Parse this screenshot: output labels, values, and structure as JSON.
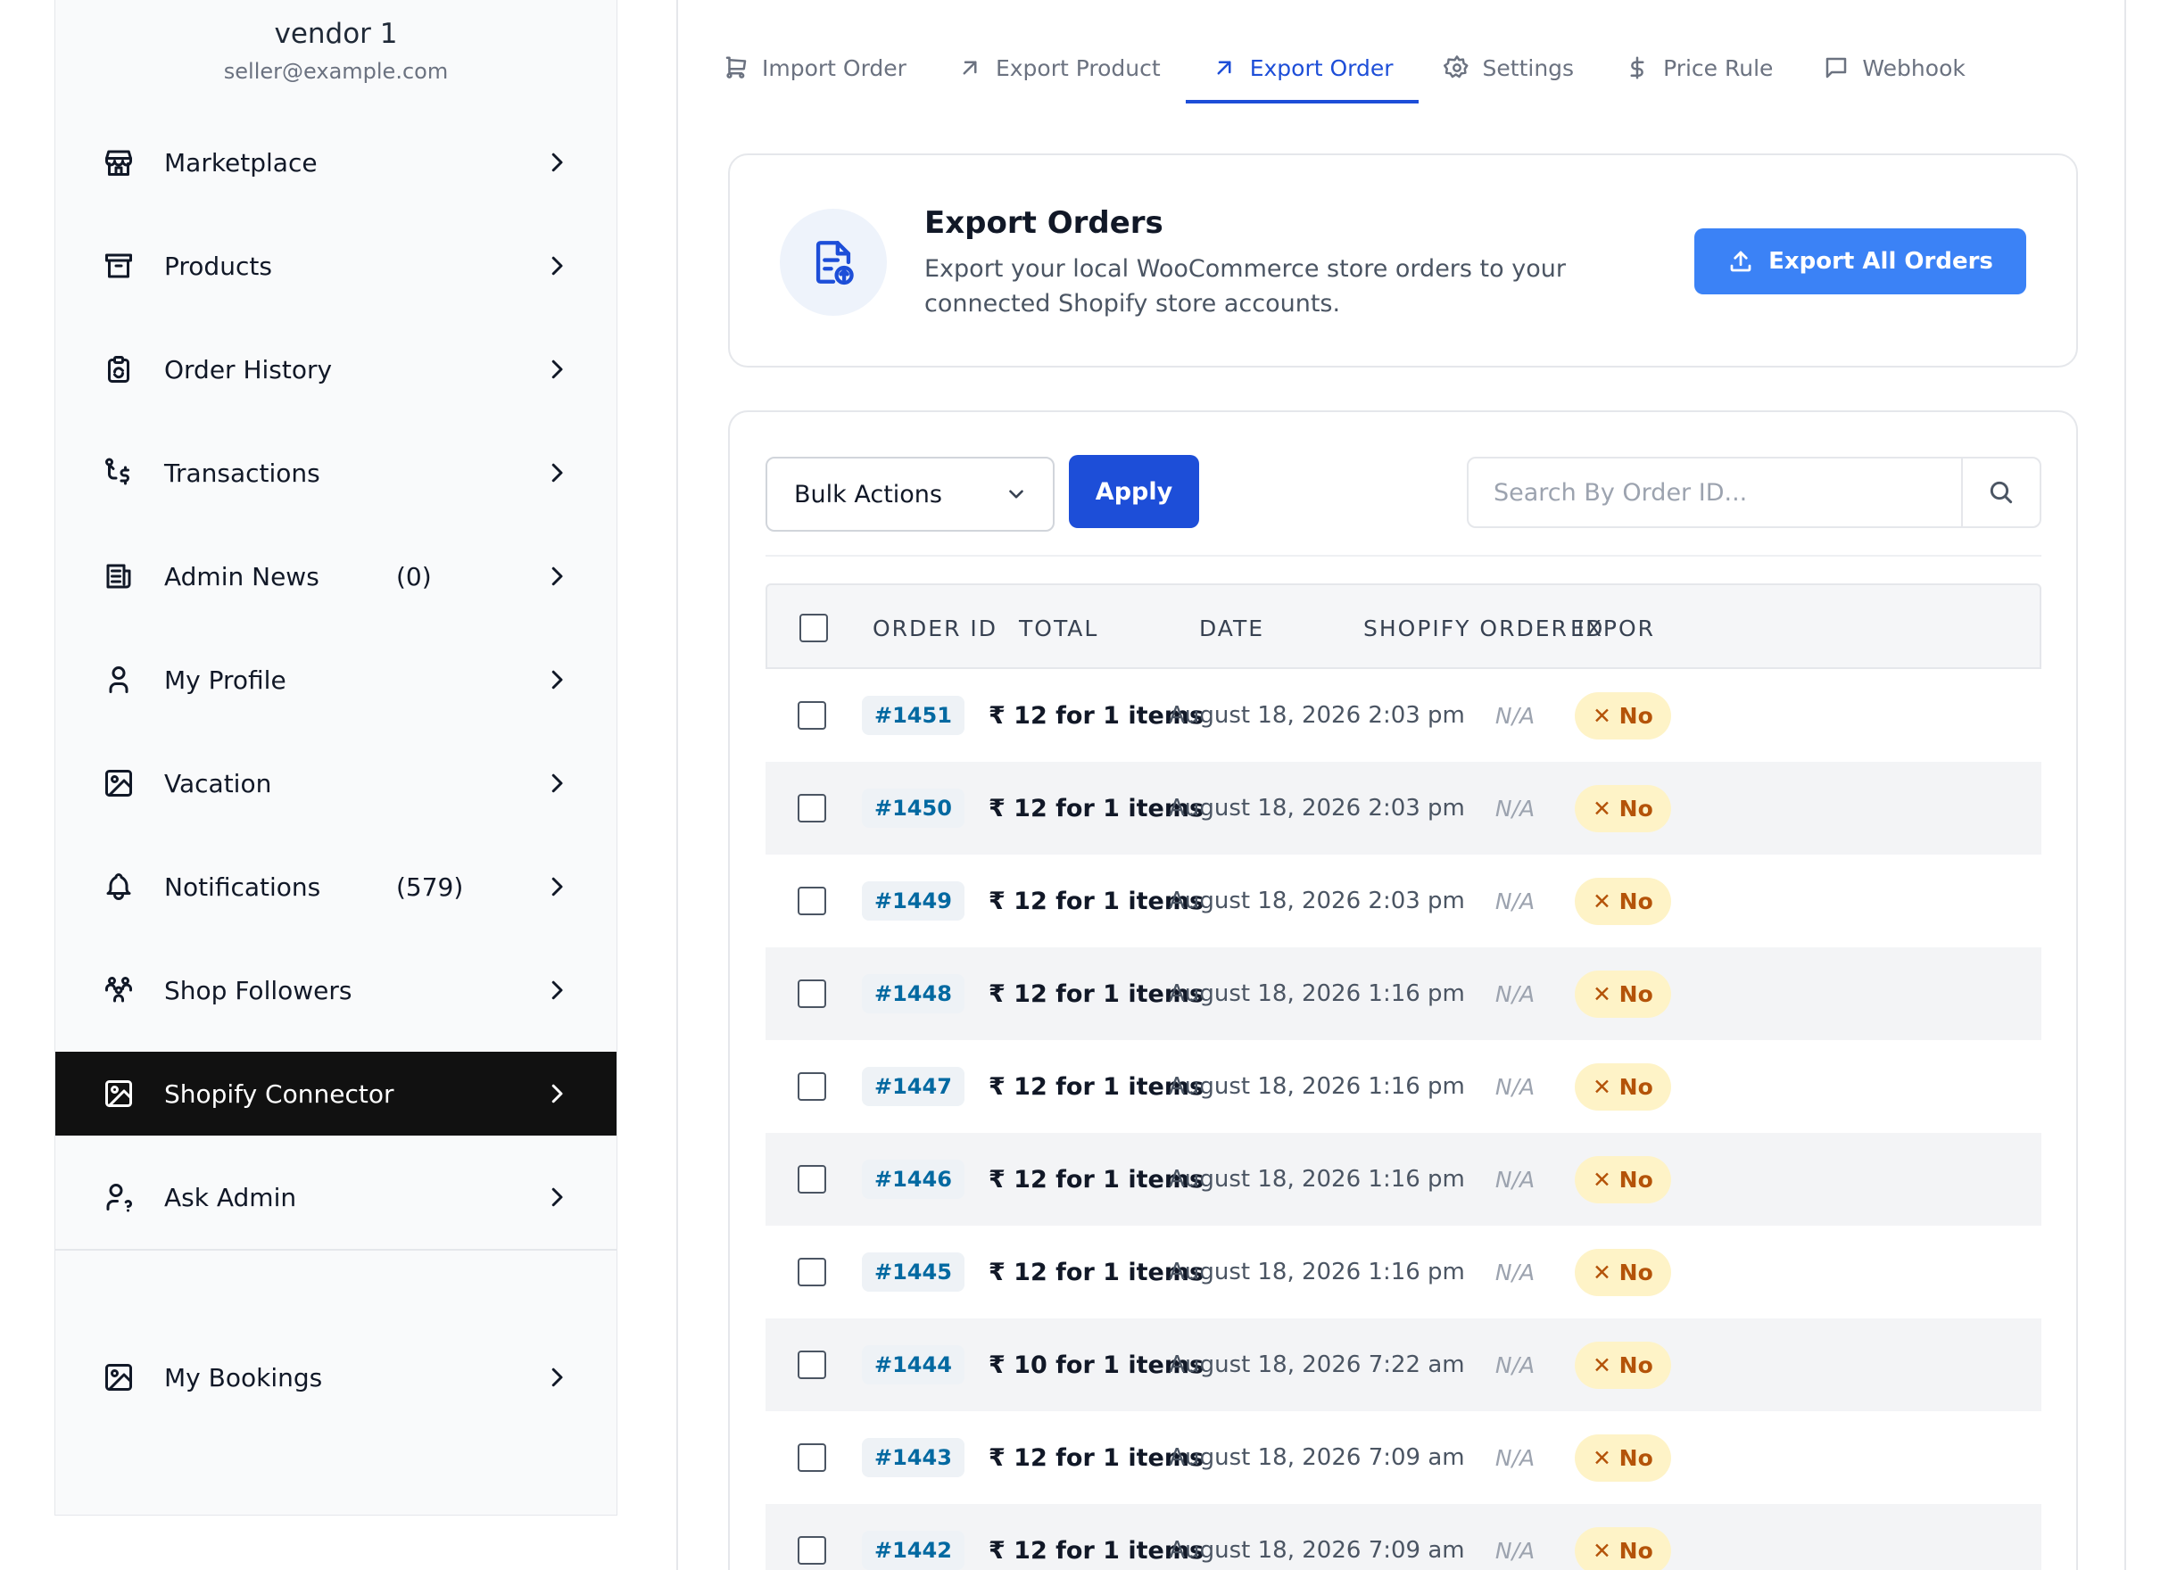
{
  "sidebar": {
    "vendor_name": "vendor 1",
    "vendor_email": "seller@example.com",
    "items": [
      {
        "label": "Marketplace",
        "icon": "store-icon",
        "count": ""
      },
      {
        "label": "Products",
        "icon": "archive-icon",
        "count": ""
      },
      {
        "label": "Order History",
        "icon": "clipboard-refresh-icon",
        "count": ""
      },
      {
        "label": "Transactions",
        "icon": "transaction-dollar-icon",
        "count": ""
      },
      {
        "label": "Admin News",
        "icon": "news-icon",
        "count": "(0)"
      },
      {
        "label": "My Profile",
        "icon": "user-icon",
        "count": ""
      },
      {
        "label": "Vacation",
        "icon": "image-icon",
        "count": ""
      },
      {
        "label": "Notifications",
        "icon": "bell-icon",
        "count": "(579)"
      },
      {
        "label": "Shop Followers",
        "icon": "users-icon",
        "count": ""
      },
      {
        "label": "Shopify Connector",
        "icon": "image-icon",
        "count": "",
        "active": true
      },
      {
        "label": "Ask Admin",
        "icon": "user-question-icon",
        "count": ""
      }
    ],
    "bottom_item": {
      "label": "My Bookings",
      "icon": "image-icon"
    }
  },
  "tabs": [
    {
      "label": "Import Order",
      "icon": "cart-icon"
    },
    {
      "label": "Export Product",
      "icon": "arrow-up-right-icon"
    },
    {
      "label": "Export Order",
      "icon": "arrow-up-right-icon",
      "active": true
    },
    {
      "label": "Settings",
      "icon": "gear-icon"
    },
    {
      "label": "Price Rule",
      "icon": "dollar-icon"
    },
    {
      "label": "Webhook",
      "icon": "message-icon"
    }
  ],
  "hero": {
    "title": "Export Orders",
    "description": "Export your local WooCommerce store orders to your connected Shopify store accounts.",
    "button_label": "Export All Orders"
  },
  "toolbar": {
    "bulk_actions": "Bulk Actions",
    "apply_label": "Apply",
    "search_placeholder": "Search By Order ID..."
  },
  "table": {
    "columns": [
      "ORDER ID",
      "TOTAL",
      "DATE",
      "SHOPIFY ORDER ID",
      "EXPOR"
    ],
    "rows": [
      {
        "id": "#1451",
        "total": "₹ 12 for 1 items",
        "date": "August 18, 2026 2:03 pm",
        "shopify": "N/A",
        "status": "✕ No"
      },
      {
        "id": "#1450",
        "total": "₹ 12 for 1 items",
        "date": "August 18, 2026 2:03 pm",
        "shopify": "N/A",
        "status": "✕ No"
      },
      {
        "id": "#1449",
        "total": "₹ 12 for 1 items",
        "date": "August 18, 2026 2:03 pm",
        "shopify": "N/A",
        "status": "✕ No"
      },
      {
        "id": "#1448",
        "total": "₹ 12 for 1 items",
        "date": "August 18, 2026 1:16 pm",
        "shopify": "N/A",
        "status": "✕ No"
      },
      {
        "id": "#1447",
        "total": "₹ 12 for 1 items",
        "date": "August 18, 2026 1:16 pm",
        "shopify": "N/A",
        "status": "✕ No"
      },
      {
        "id": "#1446",
        "total": "₹ 12 for 1 items",
        "date": "August 18, 2026 1:16 pm",
        "shopify": "N/A",
        "status": "✕ No"
      },
      {
        "id": "#1445",
        "total": "₹ 12 for 1 items",
        "date": "August 18, 2026 1:16 pm",
        "shopify": "N/A",
        "status": "✕ No"
      },
      {
        "id": "#1444",
        "total": "₹ 10 for 1 items",
        "date": "August 18, 2026 7:22 am",
        "shopify": "N/A",
        "status": "✕ No"
      },
      {
        "id": "#1443",
        "total": "₹ 12 for 1 items",
        "date": "August 18, 2026 7:09 am",
        "shopify": "N/A",
        "status": "✕ No"
      },
      {
        "id": "#1442",
        "total": "₹ 12 for 1 items",
        "date": "August 18, 2026 7:09 am",
        "shopify": "N/A",
        "status": "✕ No"
      }
    ]
  },
  "colors": {
    "accent": "#1d4ed8",
    "export_button": "#3b82f6",
    "active_nav": "#111111",
    "badge_bg": "#fef3c7",
    "badge_text": "#b45309"
  }
}
